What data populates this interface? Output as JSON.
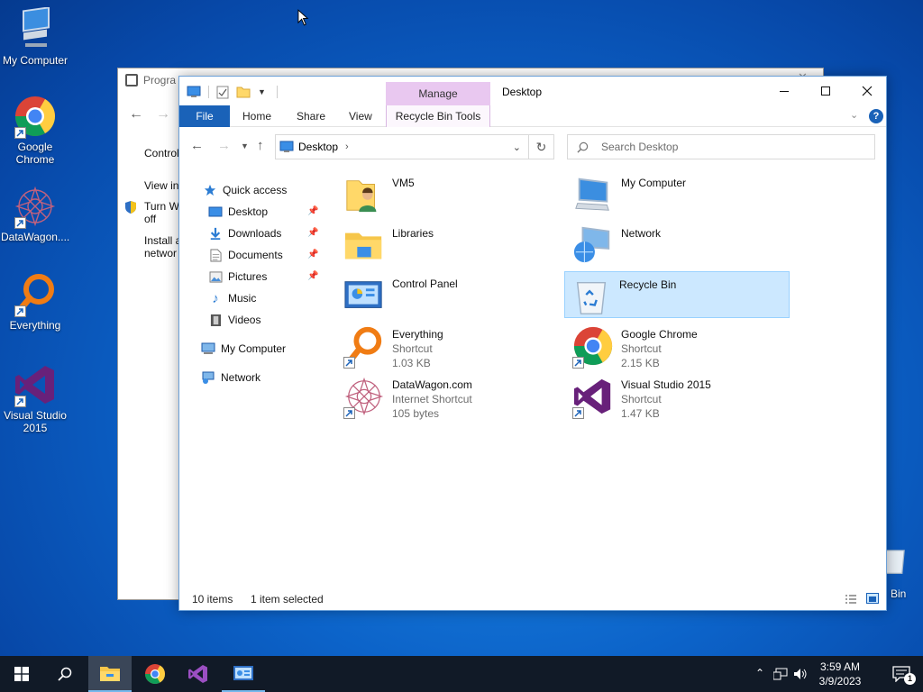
{
  "desktop": {
    "icons": [
      {
        "label": "My Computer"
      },
      {
        "label": "Google Chrome"
      },
      {
        "label": "DataWagon...."
      },
      {
        "label": "Everything"
      },
      {
        "label": "Visual Studio 2015"
      }
    ],
    "recycle_partial": "Bin"
  },
  "bg_window": {
    "title": "Progra",
    "links": [
      "Control",
      "View in",
      "Turn W off",
      "Install a networ"
    ]
  },
  "explorer": {
    "manage_tab": "Manage",
    "title": "Desktop",
    "ribbon_tabs": [
      "File",
      "Home",
      "Share",
      "View",
      "Recycle Bin Tools"
    ],
    "address": "Desktop",
    "search_placeholder": "Search Desktop",
    "nav": [
      {
        "label": "Quick access"
      },
      {
        "label": "Desktop"
      },
      {
        "label": "Downloads"
      },
      {
        "label": "Documents"
      },
      {
        "label": "Pictures"
      },
      {
        "label": "Music"
      },
      {
        "label": "Videos"
      },
      {
        "label": "My Computer"
      },
      {
        "label": "Network"
      }
    ],
    "files": [
      {
        "name": "VM5",
        "type": "",
        "size": ""
      },
      {
        "name": "My Computer",
        "type": "",
        "size": ""
      },
      {
        "name": "Libraries",
        "type": "",
        "size": ""
      },
      {
        "name": "Network",
        "type": "",
        "size": ""
      },
      {
        "name": "Control Panel",
        "type": "",
        "size": ""
      },
      {
        "name": "Recycle Bin",
        "type": "",
        "size": ""
      },
      {
        "name": "Everything",
        "type": "Shortcut",
        "size": "1.03 KB"
      },
      {
        "name": "Google Chrome",
        "type": "Shortcut",
        "size": "2.15 KB"
      },
      {
        "name": "DataWagon.com",
        "type": "Internet Shortcut",
        "size": "105 bytes"
      },
      {
        "name": "Visual Studio 2015",
        "type": "Shortcut",
        "size": "1.47 KB"
      }
    ],
    "status_items": "10 items",
    "status_selected": "1 item selected"
  },
  "taskbar": {
    "time": "3:59 AM",
    "date": "3/9/2023",
    "notification_count": "1"
  },
  "colors": {
    "accent": "#1a62b8",
    "manage_tab": "#e9c8f0",
    "selection": "#cce8ff",
    "taskbar": "#111a27"
  }
}
